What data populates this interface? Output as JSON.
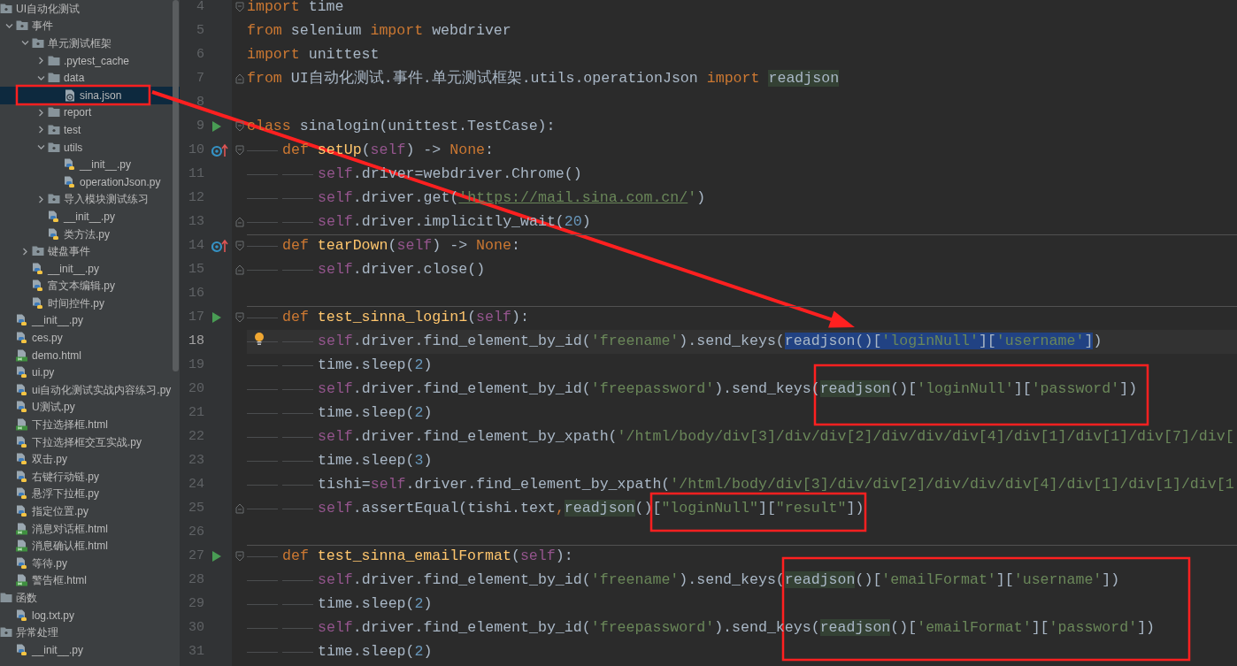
{
  "project_tree": [
    {
      "label": "UI自动化测试",
      "kind": "package",
      "selected": false,
      "children": [
        {
          "label": "事件",
          "kind": "package",
          "selected": false,
          "expanded": true,
          "children": [
            {
              "label": "单元测试框架",
              "kind": "package",
              "selected": false,
              "expanded": true,
              "children": [
                {
                  "label": ".pytest_cache",
                  "kind": "folder",
                  "selected": false,
                  "expanded": false
                },
                {
                  "label": "data",
                  "kind": "folder",
                  "selected": false,
                  "expanded": true,
                  "children": [
                    {
                      "label": "sina.json",
                      "kind": "json",
                      "selected": true
                    }
                  ]
                },
                {
                  "label": "report",
                  "kind": "folder",
                  "selected": false,
                  "expanded": false
                },
                {
                  "label": "test",
                  "kind": "package",
                  "selected": false,
                  "expanded": false
                },
                {
                  "label": "utils",
                  "kind": "package",
                  "selected": false,
                  "expanded": true,
                  "children": [
                    {
                      "label": "__init__.py",
                      "kind": "python",
                      "selected": false
                    },
                    {
                      "label": "operationJson.py",
                      "kind": "python",
                      "selected": false
                    }
                  ]
                },
                {
                  "label": "导入模块测试练习",
                  "kind": "package",
                  "selected": false,
                  "expanded": false
                },
                {
                  "label": "__init__.py",
                  "kind": "python",
                  "selected": false
                },
                {
                  "label": "类方法.py",
                  "kind": "python",
                  "selected": false
                }
              ]
            },
            {
              "label": "键盘事件",
              "kind": "package",
              "selected": false,
              "expanded": false
            },
            {
              "label": "__init__.py",
              "kind": "python",
              "selected": false
            },
            {
              "label": "富文本编辑.py",
              "kind": "python",
              "selected": false
            },
            {
              "label": "时间控件.py",
              "kind": "python",
              "selected": false
            }
          ]
        },
        {
          "label": "__init__.py",
          "kind": "python",
          "selected": false
        },
        {
          "label": "ces.py",
          "kind": "python",
          "selected": false
        },
        {
          "label": "demo.html",
          "kind": "html",
          "selected": false
        },
        {
          "label": "ui.py",
          "kind": "python",
          "selected": false
        },
        {
          "label": "ui自动化测试实战内容练习.py",
          "kind": "python",
          "selected": false
        },
        {
          "label": "U测试.py",
          "kind": "python",
          "selected": false
        },
        {
          "label": "下拉选择框.html",
          "kind": "html",
          "selected": false
        },
        {
          "label": "下拉选择框交互实战.py",
          "kind": "python",
          "selected": false
        },
        {
          "label": "双击.py",
          "kind": "python",
          "selected": false
        },
        {
          "label": "右键行动链.py",
          "kind": "python",
          "selected": false
        },
        {
          "label": "悬浮下拉框.py",
          "kind": "python",
          "selected": false
        },
        {
          "label": "指定位置.py",
          "kind": "python",
          "selected": false
        },
        {
          "label": "消息对话框.html",
          "kind": "html",
          "selected": false
        },
        {
          "label": "消息确认框.html",
          "kind": "html",
          "selected": false
        },
        {
          "label": "等待.py",
          "kind": "python",
          "selected": false
        },
        {
          "label": "警告框.html",
          "kind": "html",
          "selected": false
        }
      ]
    },
    {
      "label": "函数",
      "kind": "folder",
      "selected": false,
      "children": [
        {
          "label": "log.txt.py",
          "kind": "python",
          "selected": false
        }
      ]
    },
    {
      "label": "异常处理",
      "kind": "package",
      "selected": false,
      "children": [
        {
          "label": "__init__.py",
          "kind": "python",
          "selected": false
        }
      ]
    }
  ],
  "editor": {
    "lines": [
      {
        "number": "4",
        "current": false,
        "fold_start": true,
        "tokens": [
          {
            "text": "import",
            "kind": "keyword"
          },
          {
            "text": " time",
            "kind": "plain"
          }
        ]
      },
      {
        "number": "5",
        "current": false,
        "tokens": [
          {
            "text": "from",
            "kind": "keyword"
          },
          {
            "text": " selenium ",
            "kind": "plain"
          },
          {
            "text": "import",
            "kind": "keyword"
          },
          {
            "text": " webdriver",
            "kind": "plain"
          }
        ]
      },
      {
        "number": "6",
        "current": false,
        "tokens": [
          {
            "text": "import",
            "kind": "keyword"
          },
          {
            "text": " unittest",
            "kind": "plain"
          }
        ]
      },
      {
        "number": "7",
        "current": false,
        "fold_end": true,
        "tokens": [
          {
            "text": "from",
            "kind": "keyword"
          },
          {
            "text": " UI自动化测试.事件.单元测试框架.utils.operationJson ",
            "kind": "plain"
          },
          {
            "text": "import ",
            "kind": "keyword"
          },
          {
            "text": "readjson",
            "kind": "plain",
            "usage": true
          }
        ]
      },
      {
        "number": "8",
        "current": false
      },
      {
        "number": "9",
        "current": false,
        "run_button": true,
        "fold_start": true,
        "tokens": [
          {
            "text": "class",
            "kind": "keyword"
          },
          {
            "text": " sinalogin(unittest.TestCase):",
            "kind": "plain"
          }
        ],
        "children": [
          {
            "number": "10",
            "current": false,
            "override_marker": true,
            "fold_start": true,
            "tokens": [
              {
                "text": "def",
                "kind": "keyword"
              },
              {
                "text": " setUp",
                "kind": "function"
              },
              {
                "text": "(",
                "kind": "plain"
              },
              {
                "text": "self",
                "kind": "self"
              },
              {
                "text": ") -> ",
                "kind": "plain"
              },
              {
                "text": "None",
                "kind": "keyword"
              },
              {
                "text": ":",
                "kind": "plain"
              }
            ],
            "children": [
              {
                "number": "11",
                "current": false,
                "tokens": [
                  {
                    "text": "self",
                    "kind": "self"
                  },
                  {
                    "text": ".driver=webdriver.Chrome()",
                    "kind": "plain"
                  }
                ]
              },
              {
                "number": "12",
                "current": false,
                "tokens": [
                  {
                    "text": "self",
                    "kind": "self"
                  },
                  {
                    "text": ".driver.get(",
                    "kind": "plain"
                  },
                  {
                    "text": "'https://mail.sina.com.cn/",
                    "kind": "link"
                  },
                  {
                    "text": "'",
                    "kind": "string"
                  },
                  {
                    "text": ")",
                    "kind": "plain"
                  }
                ]
              },
              {
                "number": "13",
                "current": false,
                "fold_end": true,
                "tokens": [
                  {
                    "text": "self",
                    "kind": "self"
                  },
                  {
                    "text": ".driver.implicitly_wait(",
                    "kind": "plain"
                  },
                  {
                    "text": "20",
                    "kind": "number"
                  },
                  {
                    "text": ")",
                    "kind": "plain"
                  }
                ]
              }
            ]
          },
          {
            "number": "14",
            "current": false,
            "override_marker": true,
            "fold_start": true,
            "separator_above": true,
            "tokens": [
              {
                "text": "def",
                "kind": "keyword"
              },
              {
                "text": " tearDown",
                "kind": "function"
              },
              {
                "text": "(",
                "kind": "plain"
              },
              {
                "text": "self",
                "kind": "self"
              },
              {
                "text": ") -> ",
                "kind": "plain"
              },
              {
                "text": "None",
                "kind": "keyword"
              },
              {
                "text": ":",
                "kind": "plain"
              }
            ],
            "children": [
              {
                "number": "15",
                "current": false,
                "fold_end": true,
                "tokens": [
                  {
                    "text": "self",
                    "kind": "self"
                  },
                  {
                    "text": ".driver.close()",
                    "kind": "plain"
                  }
                ]
              }
            ]
          },
          {
            "number": "16",
            "current": false
          },
          {
            "number": "17",
            "current": false,
            "run_button": true,
            "fold_start": true,
            "separator_above": true,
            "tokens": [
              {
                "text": "def",
                "kind": "keyword"
              },
              {
                "text": " test_sinna_login1",
                "kind": "function"
              },
              {
                "text": "(",
                "kind": "plain"
              },
              {
                "text": "self",
                "kind": "self"
              },
              {
                "text": "):",
                "kind": "plain"
              }
            ],
            "children": [
              {
                "number": "18",
                "current": true,
                "bulb": true,
                "tokens": [
                  {
                    "text": "self",
                    "kind": "self"
                  },
                  {
                    "text": ".driver.find_element_by_id(",
                    "kind": "plain"
                  },
                  {
                    "text": "'freename'",
                    "kind": "string"
                  },
                  {
                    "text": ").send_keys(",
                    "kind": "plain"
                  },
                  {
                    "text": "readjson()[",
                    "kind": "plain",
                    "in_selection": true
                  },
                  {
                    "text": "'loginNull'",
                    "kind": "string",
                    "in_selection": true
                  },
                  {
                    "text": "][",
                    "kind": "plain",
                    "in_selection": true
                  },
                  {
                    "text": "'username'",
                    "kind": "string",
                    "in_selection": true
                  },
                  {
                    "text": "]",
                    "kind": "plain",
                    "in_selection": true
                  },
                  {
                    "text": ")",
                    "kind": "plain"
                  }
                ]
              },
              {
                "number": "19",
                "current": false,
                "tokens": [
                  {
                    "text": "time.sleep(",
                    "kind": "plain"
                  },
                  {
                    "text": "2",
                    "kind": "number"
                  },
                  {
                    "text": ")",
                    "kind": "plain"
                  }
                ]
              },
              {
                "number": "20",
                "current": false,
                "tokens": [
                  {
                    "text": "self",
                    "kind": "self"
                  },
                  {
                    "text": ".driver.find_element_by_id(",
                    "kind": "plain"
                  },
                  {
                    "text": "'freepassword'",
                    "kind": "string"
                  },
                  {
                    "text": ").send_keys(",
                    "kind": "plain"
                  },
                  {
                    "text": "readjson",
                    "kind": "plain",
                    "usage": true
                  },
                  {
                    "text": "()[",
                    "kind": "plain"
                  },
                  {
                    "text": "'loginNull'",
                    "kind": "string"
                  },
                  {
                    "text": "][",
                    "kind": "plain"
                  },
                  {
                    "text": "'password'",
                    "kind": "string"
                  },
                  {
                    "text": "])",
                    "kind": "plain"
                  }
                ]
              },
              {
                "number": "21",
                "current": false,
                "tokens": [
                  {
                    "text": "time.sleep(",
                    "kind": "plain"
                  },
                  {
                    "text": "2",
                    "kind": "number"
                  },
                  {
                    "text": ")",
                    "kind": "plain"
                  }
                ]
              },
              {
                "number": "22",
                "current": false,
                "tokens": [
                  {
                    "text": "self",
                    "kind": "self"
                  },
                  {
                    "text": ".driver.find_element_by_xpath(",
                    "kind": "plain"
                  },
                  {
                    "text": "'/html/body/div[3]/div/div[2]/div/div/div[4]/div[1]/div[1]/div[7]/div[",
                    "kind": "string"
                  }
                ]
              },
              {
                "number": "23",
                "current": false,
                "tokens": [
                  {
                    "text": "time.sleep(",
                    "kind": "plain"
                  },
                  {
                    "text": "3",
                    "kind": "number"
                  },
                  {
                    "text": ")",
                    "kind": "plain"
                  }
                ]
              },
              {
                "number": "24",
                "current": false,
                "tokens": [
                  {
                    "text": "tishi=",
                    "kind": "plain"
                  },
                  {
                    "text": "self",
                    "kind": "self"
                  },
                  {
                    "text": ".driver.find_element_by_xpath(",
                    "kind": "plain"
                  },
                  {
                    "text": "'/html/body/div[3]/div/div[2]/div/div/div[4]/div[1]/div[1]/div[1",
                    "kind": "string"
                  }
                ]
              },
              {
                "number": "25",
                "current": false,
                "fold_end": true,
                "tokens": [
                  {
                    "text": "self",
                    "kind": "self"
                  },
                  {
                    "text": ".assertEqual(tishi.text",
                    "kind": "plain"
                  },
                  {
                    "text": ",",
                    "kind": "keyword"
                  },
                  {
                    "text": "readjson",
                    "kind": "plain",
                    "usage": true
                  },
                  {
                    "text": "()[",
                    "kind": "plain"
                  },
                  {
                    "text": "\"loginNull\"",
                    "kind": "string"
                  },
                  {
                    "text": "][",
                    "kind": "plain"
                  },
                  {
                    "text": "\"result\"",
                    "kind": "string"
                  },
                  {
                    "text": "])",
                    "kind": "plain"
                  }
                ]
              }
            ]
          },
          {
            "number": "26",
            "current": false
          },
          {
            "number": "27",
            "current": false,
            "run_button": true,
            "fold_start": true,
            "separator_above": true,
            "tokens": [
              {
                "text": "def",
                "kind": "keyword"
              },
              {
                "text": " test_sinna_emailFormat",
                "kind": "function"
              },
              {
                "text": "(",
                "kind": "plain"
              },
              {
                "text": "self",
                "kind": "self"
              },
              {
                "text": "):",
                "kind": "plain"
              }
            ],
            "children": [
              {
                "number": "28",
                "current": false,
                "tokens": [
                  {
                    "text": "self",
                    "kind": "self"
                  },
                  {
                    "text": ".driver.find_element_by_id(",
                    "kind": "plain"
                  },
                  {
                    "text": "'freename'",
                    "kind": "string"
                  },
                  {
                    "text": ").send_keys(",
                    "kind": "plain"
                  },
                  {
                    "text": "readjson",
                    "kind": "plain",
                    "usage": true
                  },
                  {
                    "text": "()[",
                    "kind": "plain"
                  },
                  {
                    "text": "'emailFormat'",
                    "kind": "string"
                  },
                  {
                    "text": "][",
                    "kind": "plain"
                  },
                  {
                    "text": "'username'",
                    "kind": "string"
                  },
                  {
                    "text": "])",
                    "kind": "plain"
                  }
                ]
              },
              {
                "number": "29",
                "current": false,
                "tokens": [
                  {
                    "text": "time.sleep(",
                    "kind": "plain"
                  },
                  {
                    "text": "2",
                    "kind": "number"
                  },
                  {
                    "text": ")",
                    "kind": "plain"
                  }
                ]
              },
              {
                "number": "30",
                "current": false,
                "tokens": [
                  {
                    "text": "self",
                    "kind": "self"
                  },
                  {
                    "text": ".driver.find_element_by_id(",
                    "kind": "plain"
                  },
                  {
                    "text": "'freepassword'",
                    "kind": "string"
                  },
                  {
                    "text": ").send_keys(",
                    "kind": "plain"
                  },
                  {
                    "text": "readjson",
                    "kind": "plain",
                    "usage": true
                  },
                  {
                    "text": "()[",
                    "kind": "plain"
                  },
                  {
                    "text": "'emailFormat'",
                    "kind": "string"
                  },
                  {
                    "text": "][",
                    "kind": "plain"
                  },
                  {
                    "text": "'password'",
                    "kind": "string"
                  },
                  {
                    "text": "])",
                    "kind": "plain"
                  }
                ]
              },
              {
                "number": "31",
                "current": false,
                "tokens": [
                  {
                    "text": "time.sleep(",
                    "kind": "plain"
                  },
                  {
                    "text": "2",
                    "kind": "number"
                  },
                  {
                    "text": ")",
                    "kind": "plain"
                  }
                ]
              }
            ]
          }
        ]
      }
    ]
  }
}
